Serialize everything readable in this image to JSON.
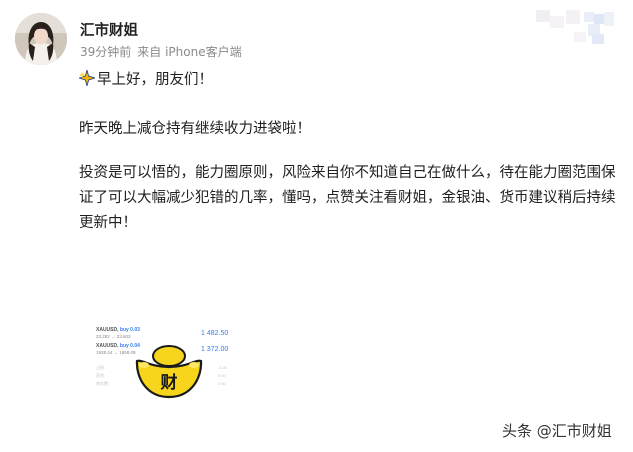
{
  "author": {
    "name": "汇市财姐",
    "time_ago": "39分钟前",
    "source": "来自 iPhone客户端"
  },
  "post": {
    "greeting": "早上好，朋友们！",
    "line2": "昨天晚上减仓持有继续收力进袋啦！",
    "line3": "投资是可以悟的，能力圈原则，风险来自你不知道自己在做什么，待在能力圈范围保证了可以大幅减少犯错的几率，懂吗，点赞关注看财姐，金银油、货币建议稍后持续更新中！"
  },
  "image": {
    "rows": [
      {
        "symbol": "XAUUSD,",
        "tag": "buy 0.03",
        "range": "23.282 → 23.603",
        "value": "1 482.50"
      },
      {
        "symbol": "XAUUSD,",
        "tag": "buy 0.04",
        "range": "1928.44 → 1958.09",
        "value": "1 372.00"
      }
    ],
    "faint_right": [
      "-4.00",
      "0.00",
      "0.00"
    ],
    "faint_left": [
      "止损:",
      "获利:",
      "库存费:"
    ],
    "ingot_char": "财"
  },
  "watermark": "头条 @汇市财姐",
  "colors": {
    "accent_blue": "#2f7ff0",
    "ingot_yellow": "#f7d51c",
    "meta_gray": "#8a8a8a"
  }
}
